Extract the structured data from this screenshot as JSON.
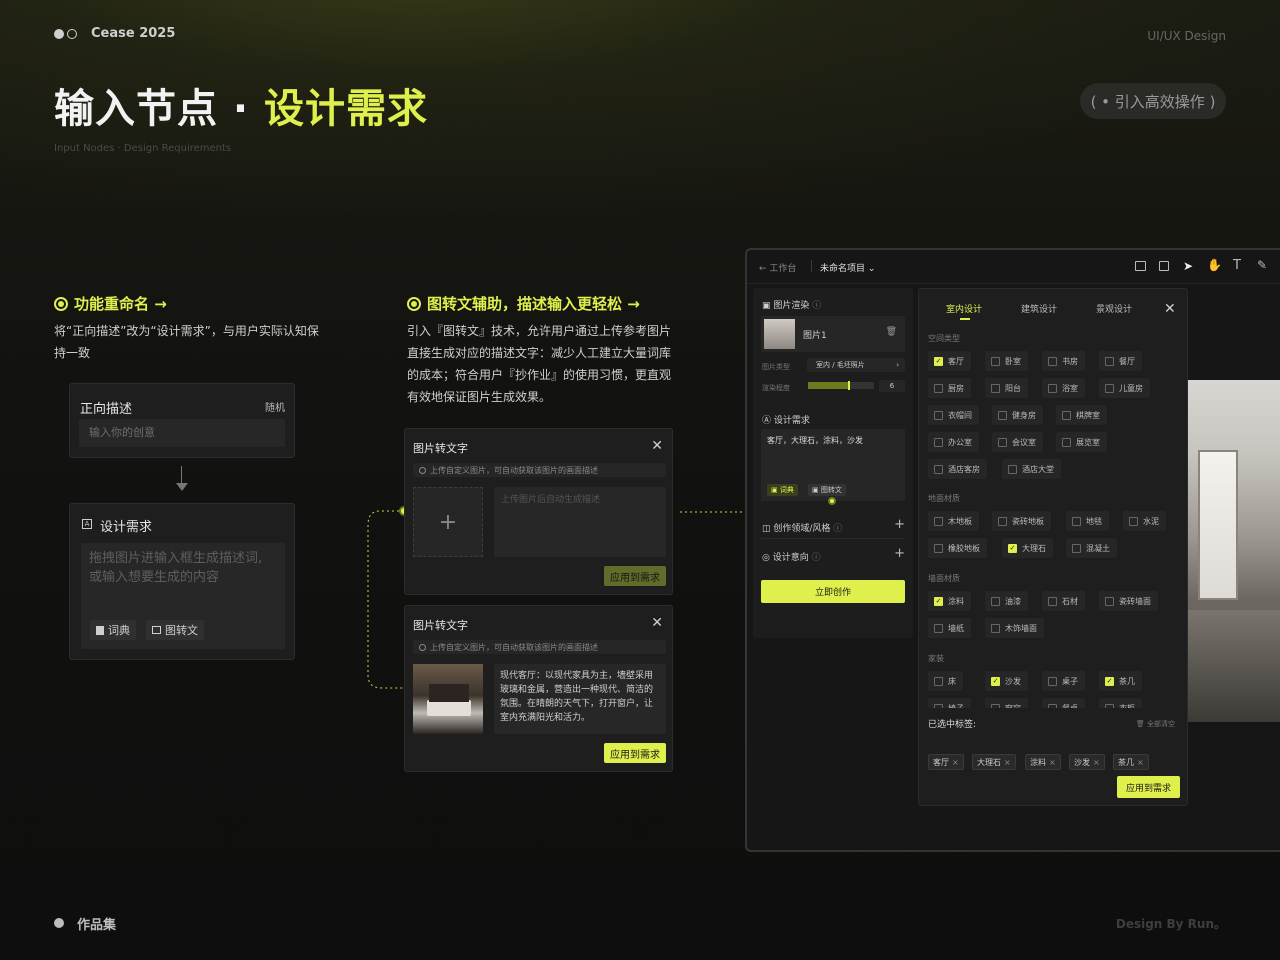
{
  "header": {
    "brand": "Cease 2025",
    "tag": "UI/UX Design",
    "title_a": "输入节点 · ",
    "title_b": "设计需求",
    "subtitle": "Input Nodes · Design Requirements",
    "pill": "( • 引入高效操作 )"
  },
  "section1": {
    "heading": "功能重命名 →",
    "body_l1": "将“正向描述”改为“设计需求”，与用户实际认知保",
    "body_l2": "持一致",
    "card_old_title": "正向描述",
    "card_old_random": "随机",
    "card_old_placeholder": "输入你的创意",
    "card_new_title": "设计需求",
    "card_new_ph1": "拖拽图片进输入框生成描述词,",
    "card_new_ph2": "或输入想要生成的内容",
    "chip_dict": "词典",
    "chip_img2txt": "图转文"
  },
  "section2": {
    "heading": "图转文辅助，描述输入更轻松 →",
    "body_l1": "引入『图转文』技术，允许用户通过上传参考图片",
    "body_l2": "直接生成对应的描述文字：减少人工建立大量词库",
    "body_l3": "的成本；符合用户『抄作业』的使用习惯，更直观",
    "body_l4": "有效地保证图片生成效果。",
    "card1_title": "图片转文字",
    "card1_hint": "上传自定义图片，可自动获取该图片的画面描述",
    "card1_plus": "+",
    "card1_placeholder": "上传图片后自动生成描述",
    "card1_btn": "应用到需求",
    "card2_title": "图片转文字",
    "card2_hint": "上传自定义图片，可自动获取该图片的画面描述",
    "card2_desc": "现代客厅：以现代家具为主，墙壁采用玻璃和金属，营造出一种现代、简洁的氛围。在晴朗的天气下，打开窗户，让室内充满阳光和活力。",
    "card2_btn": "应用到需求"
  },
  "app": {
    "back": "← 工作台",
    "project": "未命名项目 ⌄",
    "left": {
      "render_label": "图片渲染",
      "img_name": "图片1",
      "img_type_label": "图片类型",
      "img_type_value": "室内 / 毛坯照片",
      "degree_label": "渲染程度",
      "degree_value": "6",
      "degree_fraction": 0.6,
      "req_label": "设计需求",
      "req_text": "客厅，大理石，涂料，沙发",
      "chip_dict": "词典",
      "chip_img2txt": "图转文",
      "style_label": "创作领域/风格",
      "intent_label": "设计意向",
      "create_btn": "立即创作"
    },
    "modal": {
      "tabs": [
        "室内设计",
        "建筑设计",
        "景观设计"
      ],
      "groups": {
        "space": "空间类型",
        "floor": "地面材质",
        "wall": "墙面材质",
        "furniture": "家装"
      },
      "space_opts": [
        {
          "label": "客厅",
          "on": true
        },
        {
          "label": "卧室",
          "on": false
        },
        {
          "label": "书房",
          "on": false
        },
        {
          "label": "餐厅",
          "on": false
        },
        {
          "label": "厨房",
          "on": false
        },
        {
          "label": "阳台",
          "on": false
        },
        {
          "label": "浴室",
          "on": false
        },
        {
          "label": "儿童房",
          "on": false
        },
        {
          "label": "衣帽间",
          "on": false
        },
        {
          "label": "健身房",
          "on": false
        },
        {
          "label": "棋牌室",
          "on": false
        },
        {
          "label": "办公室",
          "on": false
        },
        {
          "label": "会议室",
          "on": false
        },
        {
          "label": "展览室",
          "on": false
        },
        {
          "label": "酒店客房",
          "on": false
        },
        {
          "label": "酒店大堂",
          "on": false
        }
      ],
      "floor_opts": [
        {
          "label": "木地板",
          "on": false
        },
        {
          "label": "瓷砖地板",
          "on": false
        },
        {
          "label": "地毯",
          "on": false
        },
        {
          "label": "水泥",
          "on": false
        },
        {
          "label": "橡胶地板",
          "on": false
        },
        {
          "label": "大理石",
          "on": true
        },
        {
          "label": "混凝土",
          "on": false
        }
      ],
      "wall_opts": [
        {
          "label": "涂料",
          "on": true
        },
        {
          "label": "油漆",
          "on": false
        },
        {
          "label": "石材",
          "on": false
        },
        {
          "label": "瓷砖墙面",
          "on": false
        },
        {
          "label": "墙纸",
          "on": false
        },
        {
          "label": "木饰墙面",
          "on": false
        }
      ],
      "furn_opts": [
        {
          "label": "床",
          "on": false
        },
        {
          "label": "沙发",
          "on": true
        },
        {
          "label": "桌子",
          "on": false
        },
        {
          "label": "茶几",
          "on": true
        },
        {
          "label": "椅子",
          "on": false
        },
        {
          "label": "窗帘",
          "on": false
        },
        {
          "label": "餐桌",
          "on": false
        },
        {
          "label": "衣柜",
          "on": false
        }
      ],
      "selected_label": "已选中标签:",
      "clear_all": "全部清空",
      "selected": [
        "客厅",
        "大理石",
        "涂料",
        "沙发",
        "茶几"
      ],
      "apply_btn": "应用到需求"
    }
  },
  "footer": {
    "left": "作品集",
    "right": "Design By Run。"
  },
  "colors": {
    "accent": "#dff04c",
    "bg": "#121210"
  }
}
